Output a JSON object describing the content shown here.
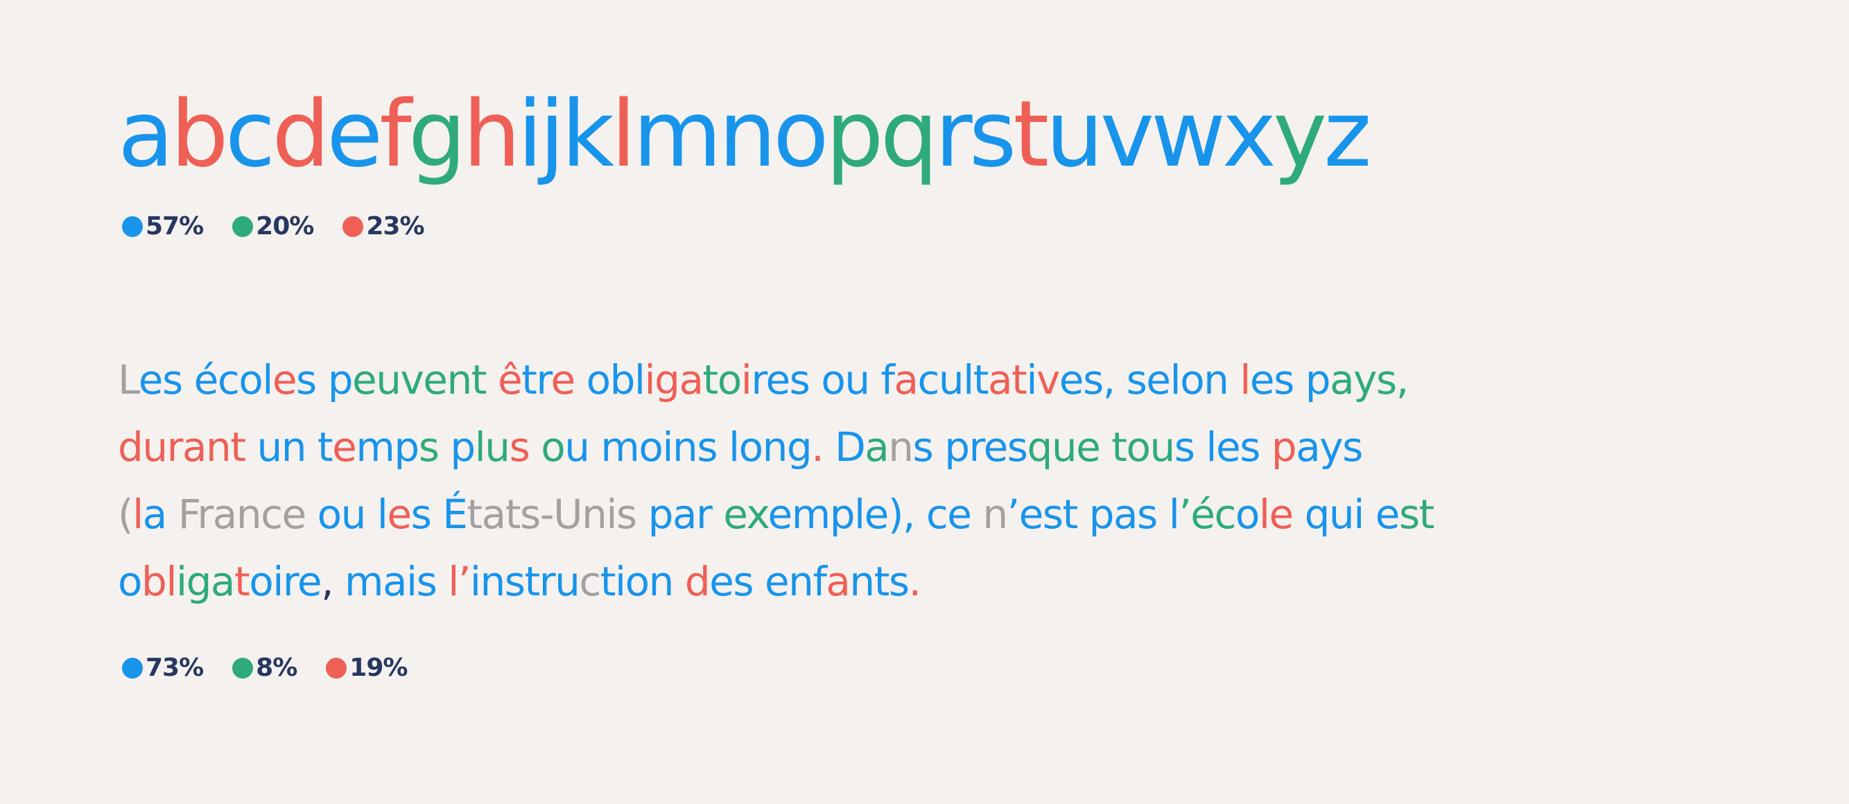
{
  "colors": {
    "blue": "#1894eb",
    "green": "#2eaa7c",
    "red": "#ee5f55",
    "gray": "#a3a19f",
    "navy": "#27375f",
    "background": "#f4f1ef"
  },
  "alphabet": {
    "text": "abcdefghijklmnopqrstuvwxyz",
    "letter_colors": "bRbRbRGRbbbRbbbGGbbRbbbbGb",
    "legend": [
      {
        "color": "blue",
        "value": "57%"
      },
      {
        "color": "green",
        "value": "20%"
      },
      {
        "color": "red",
        "value": "23%"
      }
    ]
  },
  "paragraph": {
    "lines": [
      {
        "text": "Les écoles peuvent être obligatoires ou facultatives, selon les pays,",
        "colors": "KbbbbbbbRbbbGGGGGGGRbbRbbbbRRRGGRbbbbbbbbRbbbbRRbRbbbbbbbbbbRbbbbGGGGK"
      },
      {
        "text": "durant un temps plus ou moins long. Dans presque tous les pays",
        "colors": "RRRRRRbbbbbRbbGGbGGRGGbbbbbbbbbbbbRbbGKbKbbbbGGGGGGGbRbbbbRbbbbGGGG"
      },
      {
        "text": "(la France ou les États-Unis par exemple), ce n’est pas l’école qui est",
        "colors": "KRbbKKKKKKbbbbbRbbbKKKKKKKKKbbbbGGGbbbbbbbGbbKKbbbbbbbbbbGGGbRRbbbbRbGGGbbbbR"
      },
      {
        "text": "obligatoire, mais l’instruction des enfants.",
        "colors": "bRRGGGRbbbbNbbbbbbRRbbbbbbKbbbbbRbbbbbbRbbbRbK"
      }
    ],
    "legend": [
      {
        "color": "blue",
        "value": "73%"
      },
      {
        "color": "green",
        "value": "8%"
      },
      {
        "color": "red",
        "value": "19%"
      }
    ]
  }
}
